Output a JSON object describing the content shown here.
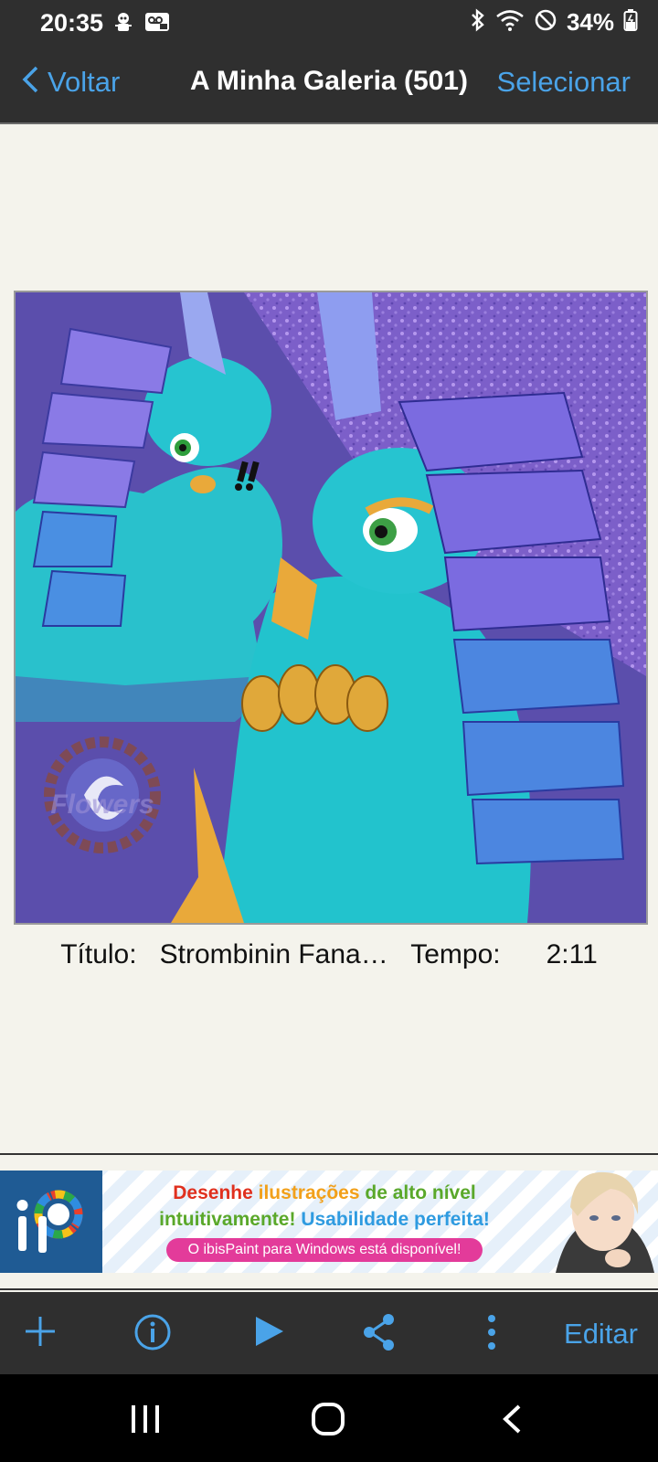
{
  "status_bar": {
    "time": "20:35",
    "left_icons": [
      "robot-icon",
      "voicemail-icon"
    ],
    "right_icons": [
      "bluetooth-icon",
      "wifi-icon",
      "do-not-disturb-icon",
      "battery-icon"
    ],
    "battery": "34%"
  },
  "nav": {
    "back_label": "Voltar",
    "title": "A Minha Galeria (501)",
    "select_label": "Selecionar"
  },
  "artwork": {
    "watermark": "Flowers"
  },
  "info": {
    "title_label": "Título:",
    "title_value": "Strombinin Fana…",
    "time_label": "Tempo:",
    "time_value": "2:11"
  },
  "ad": {
    "line1_part1": "Desenhe",
    "line1_part2": "ilustrações",
    "line1_part3": "de alto nível",
    "line2_part1": "intuitivamente!",
    "line2_part2": "Usabilidade perfeita!",
    "cta": "O ibisPaint para Windows está disponível!",
    "colors": {
      "red": "#e0301e",
      "orange": "#f2a01a",
      "green": "#5aa82a",
      "blue": "#2f9be0",
      "pink": "#e33b9a"
    }
  },
  "toolbar": {
    "items": [
      "add-icon",
      "info-icon",
      "play-icon",
      "share-icon",
      "more-icon"
    ],
    "edit_label": "Editar"
  },
  "system_nav": [
    "recent-apps-icon",
    "home-icon",
    "back-icon"
  ],
  "colors": {
    "accent": "#4aa3e8",
    "bar_bg": "#2f2f2f",
    "page_bg": "#f4f3ec"
  }
}
